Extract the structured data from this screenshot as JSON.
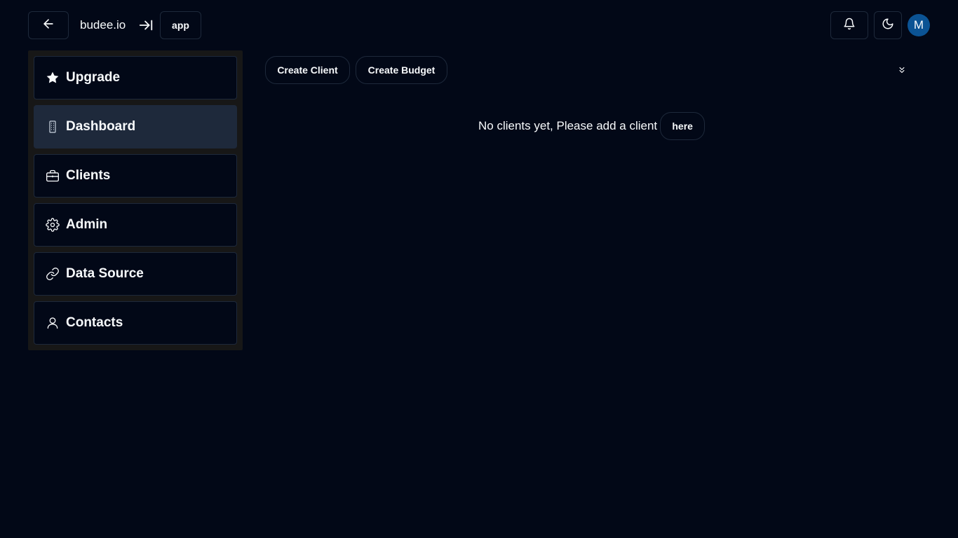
{
  "header": {
    "back_icon": "arrow-left-icon",
    "brand": "budee.io",
    "collapse_icon": "arrow-right-to-line-icon",
    "app_label": "app",
    "notifications_icon": "bell-icon",
    "theme_icon": "moon-icon",
    "avatar_initial": "M",
    "avatar_color": "#0b5394"
  },
  "sidebar": {
    "items": [
      {
        "label": "Upgrade",
        "icon": "star-icon"
      },
      {
        "label": "Dashboard",
        "icon": "building-icon",
        "active": true
      },
      {
        "label": "Clients",
        "icon": "briefcase-icon"
      },
      {
        "label": "Admin",
        "icon": "gear-icon"
      },
      {
        "label": "Data Source",
        "icon": "link-icon"
      },
      {
        "label": "Contacts",
        "icon": "user-icon"
      }
    ]
  },
  "toolbar": {
    "create_client_label": "Create Client",
    "create_budget_label": "Create Budget",
    "expand_icon": "chevrons-down-icon"
  },
  "main": {
    "empty_message": "No clients yet, Please add a client",
    "here_label": "here"
  },
  "colors": {
    "background": "#020817",
    "border": "#1e293b",
    "sidebar_bg": "#171717",
    "active_item_bg": "#1e293b",
    "text": "#f8fafc"
  }
}
